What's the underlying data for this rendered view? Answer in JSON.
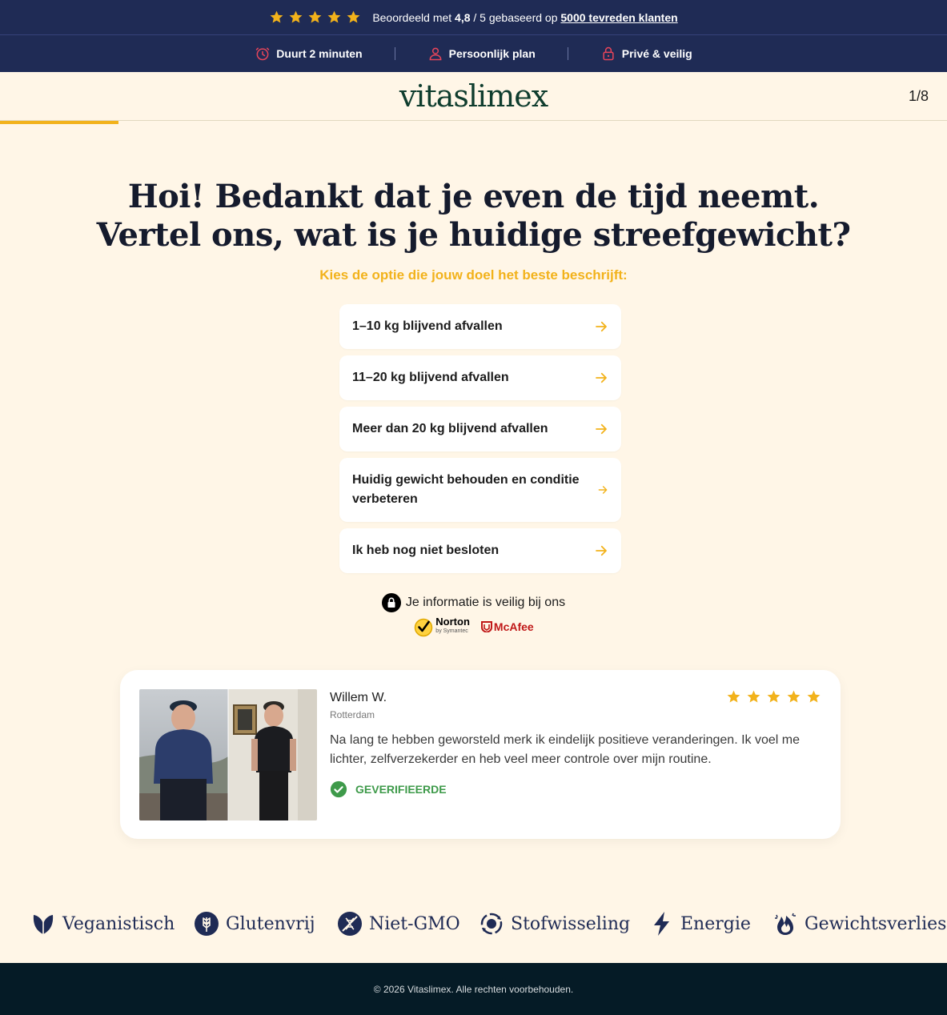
{
  "topbar": {
    "rating_prefix": "Beoordeeld met ",
    "rating_value": "4,8",
    "rating_mid": " / 5 gebaseerd op ",
    "rating_link": "5000 tevreden klanten",
    "star_count": 5,
    "features": [
      {
        "label": "Duurt 2 minuten",
        "icon": "clock-icon"
      },
      {
        "label": "Persoonlijk plan",
        "icon": "person-icon"
      },
      {
        "label": "Privé & veilig",
        "icon": "lock-icon"
      }
    ]
  },
  "header": {
    "logo": "vitaslimex",
    "step": "1/8",
    "progress_fraction": 0.125
  },
  "question": {
    "title": "Hoi! Bedankt dat je even de tijd neemt. Vertel ons, wat is je huidige streefgewicht?",
    "subtitle": "Kies de optie die jouw doel het beste beschrijft:",
    "options": [
      {
        "label": "1–10 kg blijvend afvallen"
      },
      {
        "label": "11–20 kg blijvend afvallen"
      },
      {
        "label": "Meer dan 20 kg blijvend afvallen"
      },
      {
        "label": "Huidig gewicht behouden en conditie verbeteren"
      },
      {
        "label": "Ik heb nog niet besloten"
      }
    ]
  },
  "security": {
    "text": "Je informatie is veilig bij ons",
    "norton": "Norton",
    "norton_sub": "by Symantec",
    "mcafee": "McAfee"
  },
  "review": {
    "name": "Willem W.",
    "city": "Rotterdam",
    "text": "Na lang te hebben geworsteld merk ik eindelijk positieve veranderingen. Ik voel me lichter, zelfverzekerder en heb veel meer controle over mijn routine.",
    "verified": "GEVERIFIEERDE",
    "star_count": 5
  },
  "features": [
    {
      "label": "Veganistisch",
      "icon": "leaf-icon"
    },
    {
      "label": "Glutenvrij",
      "icon": "wheat-icon"
    },
    {
      "label": "Niet-GMO",
      "icon": "non-gmo-icon"
    },
    {
      "label": "Stofwisseling",
      "icon": "metabolism-icon"
    },
    {
      "label": "Energie",
      "icon": "lightning-icon"
    },
    {
      "label": "Gewichtsverlies",
      "icon": "flame-icon"
    }
  ],
  "footer": {
    "copyright": "© 2026 Vitaslimex. Alle rechten voorbehouden."
  },
  "colors": {
    "navy": "#1f2b55",
    "accent": "#f2b21b",
    "background": "#fff6e7",
    "logo_green": "#0f3d2e",
    "verified_green": "#3e9a4a",
    "footer": "#051b26"
  }
}
